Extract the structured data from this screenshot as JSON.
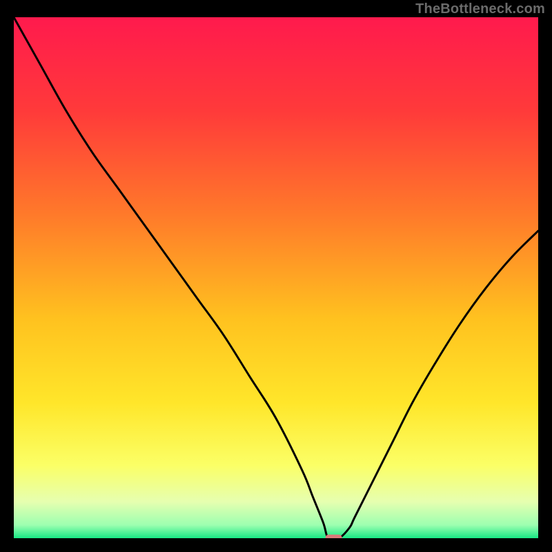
{
  "watermark": "TheBottleneck.com",
  "chart_data": {
    "type": "line",
    "title": "",
    "xlabel": "",
    "ylabel": "",
    "xlim": [
      0,
      100
    ],
    "ylim": [
      0,
      100
    ],
    "grid": false,
    "background_gradient_stops": [
      {
        "pos": 0.0,
        "color": "#ff1a4d"
      },
      {
        "pos": 0.18,
        "color": "#ff3a3a"
      },
      {
        "pos": 0.38,
        "color": "#ff7a2a"
      },
      {
        "pos": 0.58,
        "color": "#ffc21f"
      },
      {
        "pos": 0.74,
        "color": "#ffe62a"
      },
      {
        "pos": 0.86,
        "color": "#fbff66"
      },
      {
        "pos": 0.93,
        "color": "#e6ffb0"
      },
      {
        "pos": 0.975,
        "color": "#9cffb0"
      },
      {
        "pos": 1.0,
        "color": "#17e884"
      }
    ],
    "series": [
      {
        "name": "bottleneck-curve",
        "color": "#000000",
        "x": [
          0,
          5,
          10,
          15,
          20,
          25,
          30,
          35,
          40,
          45,
          50,
          55,
          57,
          59,
          60,
          62,
          64,
          65,
          68,
          72,
          76,
          80,
          85,
          90,
          95,
          100
        ],
        "values": [
          100,
          91,
          82,
          74,
          67,
          60,
          53,
          46,
          39,
          31,
          23,
          13,
          8,
          3,
          0,
          0,
          2,
          4,
          10,
          18,
          26,
          33,
          41,
          48,
          54,
          59
        ]
      }
    ],
    "marker": {
      "name": "sweet-spot",
      "shape": "rounded-rect",
      "x": 61,
      "y": 0,
      "width_pct": 3.2,
      "height_pct": 1.4,
      "fill": "#d97a7a"
    }
  }
}
